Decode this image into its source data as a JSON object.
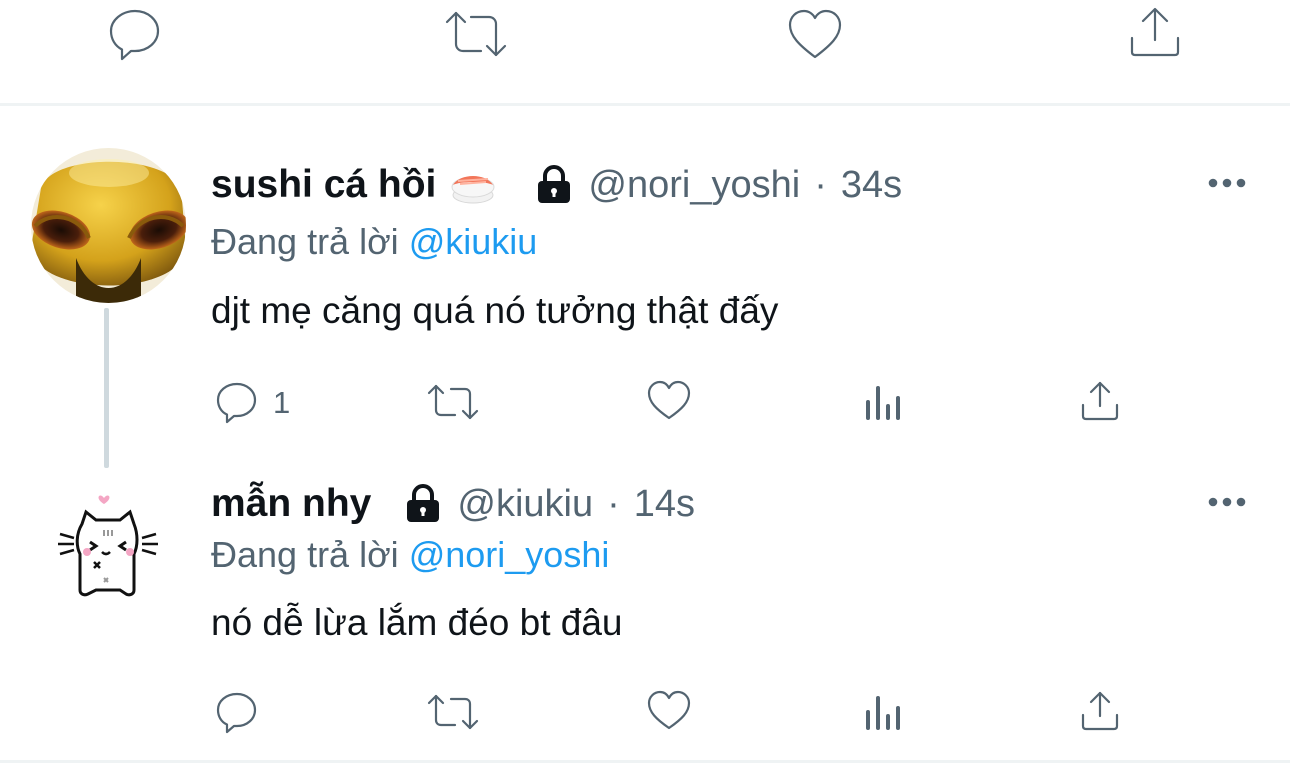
{
  "colors": {
    "accent": "#1d9bf0",
    "muted": "#536471",
    "text": "#0f1419",
    "divider": "#eff3f4",
    "thread_line": "#cfd9de"
  },
  "top_actions": {
    "icons": [
      "reply-icon",
      "retweet-icon",
      "like-icon",
      "share-icon"
    ]
  },
  "tweets": [
    {
      "display_name": "sushi cá hồi",
      "emoji": "sushi-emoji",
      "protected_icon": "lock-icon",
      "handle": "@nori_yoshi",
      "separator": "·",
      "time": "34s",
      "reply_prefix": "Đang trả lời",
      "reply_to": "@kiukiu",
      "text": "djt mẹ căng quá nó tưởng thật đấy",
      "reply_count": "1",
      "avatar": "yellow-creature-avatar",
      "actions": [
        "reply-icon",
        "retweet-icon",
        "like-icon",
        "analytics-icon",
        "share-icon"
      ]
    },
    {
      "display_name": "mẫn nhy",
      "protected_icon": "lock-icon",
      "handle": "@kiukiu",
      "separator": "·",
      "time": "14s",
      "reply_prefix": "Đang trả lời",
      "reply_to": "@nori_yoshi",
      "text": "nó dễ lừa lắm đéo bt đâu",
      "reply_count": "",
      "avatar": "cat-doodle-avatar",
      "actions": [
        "reply-icon",
        "retweet-icon",
        "like-icon",
        "analytics-icon",
        "share-icon"
      ]
    }
  ]
}
